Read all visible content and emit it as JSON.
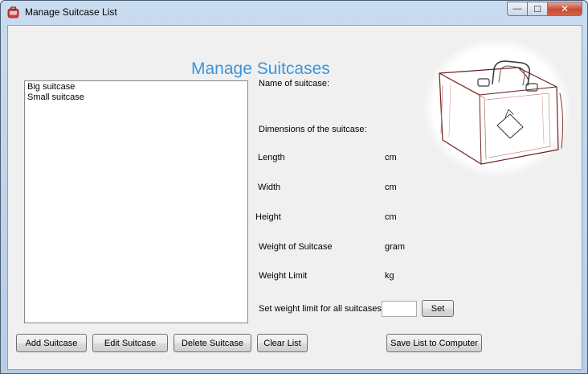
{
  "window": {
    "title": "Manage Suitcase List",
    "minimize_glyph": "—",
    "maximize_glyph": "☐",
    "close_glyph": "✕"
  },
  "heading": "Manage Suitcases",
  "list": {
    "items": [
      "Big suitcase",
      "Small suitcase"
    ]
  },
  "fields": {
    "name_label": "Name of suitcase:",
    "dimensions_label": "Dimensions of the suitcase:",
    "length_label": "Length",
    "length_unit": "cm",
    "width_label": "Width",
    "width_unit": "cm",
    "height_label": "Height",
    "height_unit": "cm",
    "weight_label": "Weight of Suitcase",
    "weight_unit": "gram",
    "weight_limit_label": "Weight Limit",
    "weight_limit_unit": "kg",
    "set_all_label": "Set weight limit for all suitcases",
    "set_all_value": "",
    "set_button": "Set"
  },
  "buttons": {
    "add": "Add Suitcase",
    "edit": "Edit Suitcase",
    "delete": "Delete Suitcase",
    "clear": "Clear List",
    "save": "Save List to Computer"
  },
  "colors": {
    "heading": "#3a96dd",
    "app_icon": "#d83a3a"
  }
}
